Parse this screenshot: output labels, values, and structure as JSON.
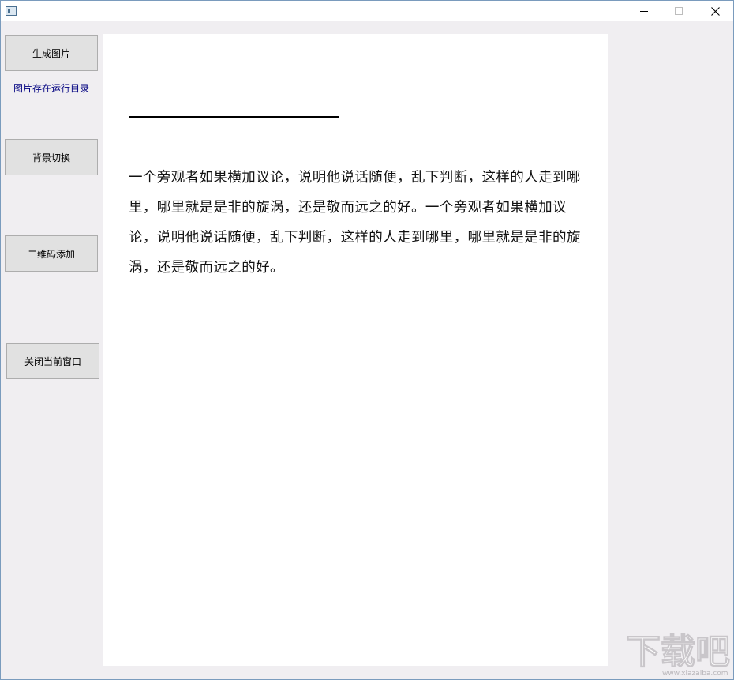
{
  "window": {
    "title": ""
  },
  "sidebar": {
    "generate_label": "生成图片",
    "save_hint": "图片存在运行目录",
    "background_label": "背景切换",
    "qrcode_label": "二维码添加",
    "close_label": "关闭当前窗口"
  },
  "canvas": {
    "body_text": "一个旁观者如果横加议论，说明他说话随便，乱下判断，这样的人走到哪里，哪里就是是非的旋涡，还是敬而远之的好。一个旁观者如果横加议论，说明他说话随便，乱下判断，这样的人走到哪里，哪里就是是非的旋涡，还是敬而远之的好。"
  },
  "watermark": {
    "text": "下载吧",
    "url": "www.xiazaiba.com"
  },
  "icons": {
    "minimize": "minimize-icon",
    "maximize": "maximize-icon",
    "close": "close-icon",
    "app": "app-icon"
  }
}
